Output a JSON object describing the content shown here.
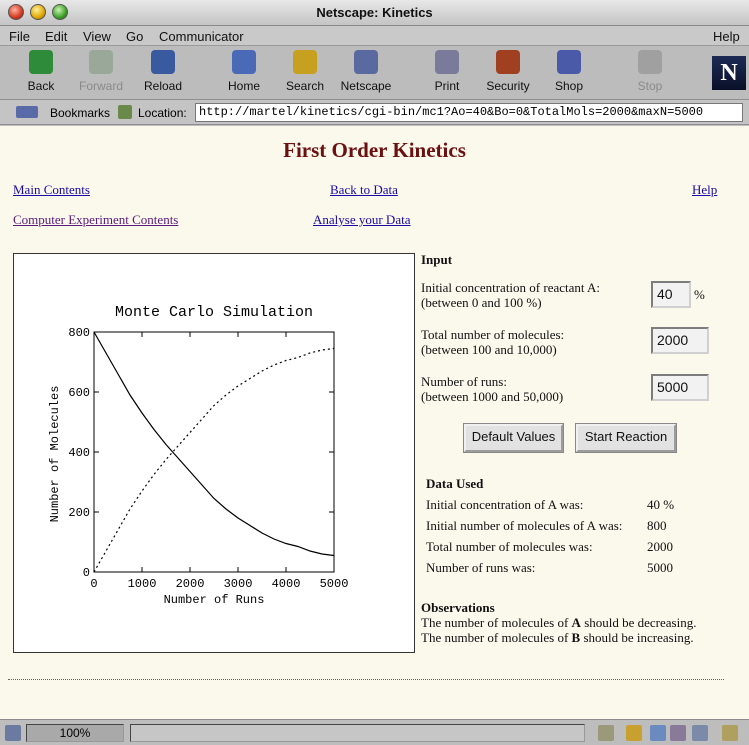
{
  "window": {
    "title": "Netscape: Kinetics"
  },
  "menu": [
    "File",
    "Edit",
    "View",
    "Go",
    "Communicator",
    "Help"
  ],
  "toolbar": {
    "buttons": [
      {
        "label": "Back",
        "icon": "back-arrow-icon",
        "color": "#2e8b3a"
      },
      {
        "label": "Forward",
        "icon": "forward-arrow-icon",
        "color": "#9aa89a"
      },
      {
        "label": "Reload",
        "icon": "reload-icon",
        "color": "#3a5aa0"
      },
      {
        "label": "Home",
        "icon": "home-icon",
        "color": "#4a6ab8"
      },
      {
        "label": "Search",
        "icon": "search-icon",
        "color": "#c8a020"
      },
      {
        "label": "Netscape",
        "icon": "netscape-icon",
        "color": "#5a6aa0"
      },
      {
        "label": "Print",
        "icon": "print-icon",
        "color": "#7a7a9a"
      },
      {
        "label": "Security",
        "icon": "lock-icon",
        "color": "#a04020"
      },
      {
        "label": "Shop",
        "icon": "shop-icon",
        "color": "#4a5aa8"
      },
      {
        "label": "Stop",
        "icon": "stop-icon",
        "color": "#a0a0a0"
      }
    ],
    "logo": "N"
  },
  "location": {
    "bookmarks_label": "Bookmarks",
    "location_label": "Location:",
    "url": "http://martel/kinetics/cgi-bin/mc1?Ao=40&Bo=0&TotalMols=2000&maxN=5000"
  },
  "page": {
    "title": "First Order Kinetics",
    "links": {
      "main_contents": "Main Contents",
      "back_to_data": "Back to Data",
      "help": "Help",
      "computer_experiment": "Computer Experiment Contents",
      "analyse": "Analyse your Data"
    },
    "input": {
      "heading": "Input",
      "conc_label_1": "Initial concentration of reactant A:",
      "conc_label_2": "(between 0 and 100 %)",
      "conc_value": "40",
      "conc_unit": "%",
      "total_label_1": "Total number of molecules:",
      "total_label_2": "(between 100 and 10,000)",
      "total_value": "2000",
      "runs_label_1": "Number of runs:",
      "runs_label_2": "(between 1000 and 50,000)",
      "runs_value": "5000",
      "default_button": "Default Values",
      "start_button": "Start Reaction"
    },
    "data_used": {
      "heading": "Data Used",
      "rows": [
        {
          "label": "Initial concentration of A was:",
          "value": "40 %"
        },
        {
          "label": "Initial number of molecules of A was:",
          "value": "800"
        },
        {
          "label": "Total number of molecules was:",
          "value": "2000"
        },
        {
          "label": "Number of runs was:",
          "value": "5000"
        }
      ]
    },
    "observations": {
      "heading": "Observations",
      "line1_pre": "The number of molecules of ",
      "line1_bold": "A",
      "line1_post": " should be decreasing.",
      "line2_pre": "The number of molecules of ",
      "line2_bold": "B",
      "line2_post": " should be increasing."
    }
  },
  "status": {
    "zoom": "100%"
  },
  "chart_data": {
    "type": "line",
    "title": "Monte Carlo Simulation",
    "xlabel": "Number of Runs",
    "ylabel": "Number of Molecules",
    "xlim": [
      0,
      5000
    ],
    "ylim": [
      0,
      800
    ],
    "xticks": [
      0,
      1000,
      2000,
      3000,
      4000,
      5000
    ],
    "yticks": [
      0,
      200,
      400,
      600,
      800
    ],
    "grid": false,
    "series": [
      {
        "style": "solid",
        "x": [
          0,
          250,
          500,
          750,
          1000,
          1250,
          1500,
          1750,
          2000,
          2250,
          2500,
          2750,
          3000,
          3250,
          3500,
          3750,
          4000,
          4250,
          4500,
          4750,
          5000
        ],
        "y": [
          800,
          730,
          660,
          590,
          530,
          475,
          425,
          380,
          335,
          290,
          245,
          210,
          180,
          155,
          130,
          110,
          95,
          85,
          70,
          60,
          55
        ]
      },
      {
        "style": "dotted",
        "x": [
          0,
          250,
          500,
          750,
          1000,
          1250,
          1500,
          1750,
          2000,
          2250,
          2500,
          2750,
          3000,
          3250,
          3500,
          3750,
          4000,
          4250,
          4500,
          4750,
          5000
        ],
        "y": [
          0,
          70,
          140,
          210,
          270,
          325,
          375,
          420,
          465,
          510,
          555,
          590,
          620,
          645,
          670,
          690,
          705,
          715,
          730,
          740,
          745
        ]
      }
    ]
  }
}
